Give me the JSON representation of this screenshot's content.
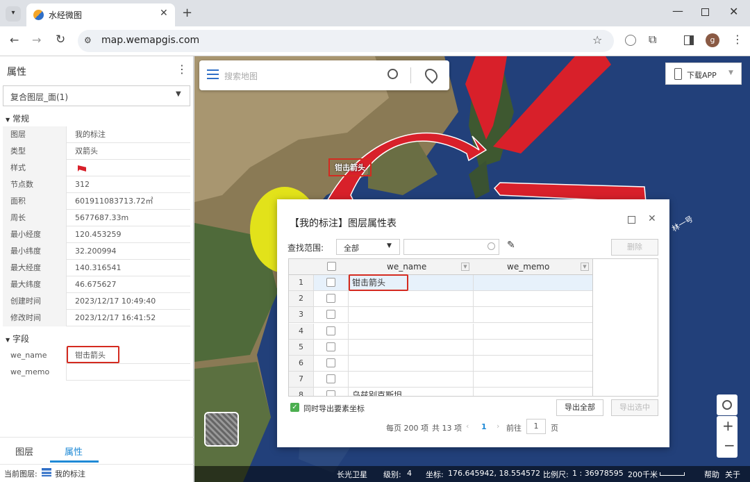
{
  "browser": {
    "tab_title": "水经微图",
    "url": "map.wemapgis.com",
    "profile_initial": "g"
  },
  "panel": {
    "title": "属性",
    "layer_select": "复合图层_面(1)",
    "section_general": "常规",
    "rows": [
      {
        "k": "图层",
        "v": "我的标注"
      },
      {
        "k": "类型",
        "v": "双箭头"
      },
      {
        "k": "样式",
        "v": ""
      },
      {
        "k": "节点数",
        "v": "312"
      },
      {
        "k": "面积",
        "v": "601911083713.72㎡"
      },
      {
        "k": "周长",
        "v": "5677687.33m"
      },
      {
        "k": "最小经度",
        "v": "120.453259"
      },
      {
        "k": "最小纬度",
        "v": "32.200994"
      },
      {
        "k": "最大经度",
        "v": "140.316541"
      },
      {
        "k": "最大纬度",
        "v": "46.675627"
      },
      {
        "k": "创建时间",
        "v": "2023/12/17 10:49:40"
      },
      {
        "k": "修改时间",
        "v": "2023/12/17 16:41:52"
      }
    ],
    "section_fields": "字段",
    "fields": [
      {
        "k": "we_name",
        "v": "钳击箭头"
      },
      {
        "k": "we_memo",
        "v": ""
      }
    ],
    "tabs": [
      "图层",
      "属性"
    ],
    "current_layer_label": "当前图层:",
    "current_layer": "我的标注"
  },
  "map": {
    "search_placeholder": "搜索地图",
    "download_app": "下载APP",
    "label": "钳击箭头",
    "side_text": "林一号",
    "status": {
      "source": "长光卫星",
      "level_label": "级别:",
      "level": "4",
      "coord_label": "坐标:",
      "coord": "176.645942, 18.554572",
      "scale_label": "比例尺:",
      "scale": "1 : 36978595",
      "scale_bar": "200千米",
      "help": "帮助",
      "about": "关于"
    }
  },
  "dialog": {
    "title": "【我的标注】图层属性表",
    "search_label": "查找范围:",
    "scope": "全部",
    "delete": "删除",
    "columns": [
      "we_name",
      "we_memo"
    ],
    "rows": [
      {
        "n": "1",
        "name": "钳击箭头",
        "memo": ""
      },
      {
        "n": "2",
        "name": "",
        "memo": ""
      },
      {
        "n": "3",
        "name": "",
        "memo": ""
      },
      {
        "n": "4",
        "name": "",
        "memo": ""
      },
      {
        "n": "5",
        "name": "",
        "memo": ""
      },
      {
        "n": "6",
        "name": "",
        "memo": ""
      },
      {
        "n": "7",
        "name": "",
        "memo": ""
      },
      {
        "n": "8",
        "name": "乌兹别克斯坦",
        "memo": ""
      }
    ],
    "export_coords": "同时导出要素坐标",
    "export_all": "导出全部",
    "export_selected": "导出选中",
    "pager": {
      "per_page": "每页 200 项",
      "total": "共 13 项",
      "page": "1",
      "goto": "前往",
      "page_input": "1",
      "page_unit": "页"
    }
  },
  "colors": {
    "accent": "#1f8ad6",
    "arrow": "#d8202a",
    "highlight": "#d42a20"
  }
}
